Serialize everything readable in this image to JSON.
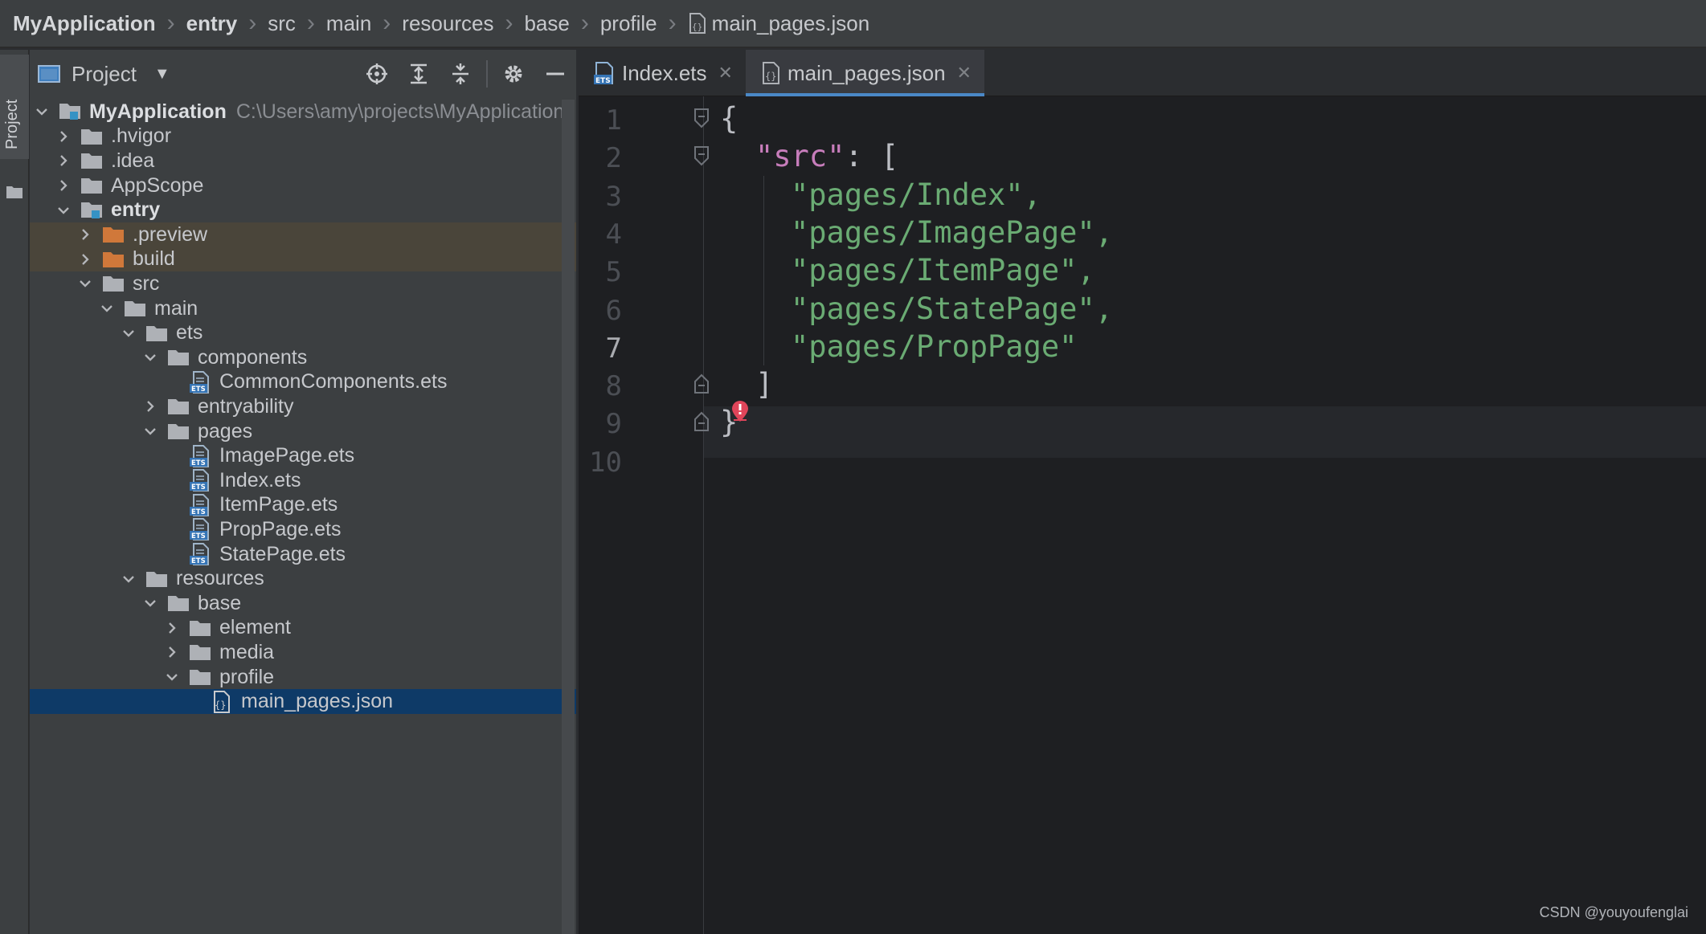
{
  "breadcrumb": {
    "items": [
      "MyApplication",
      "entry",
      "src",
      "main",
      "resources",
      "base",
      "profile",
      "main_pages.json"
    ]
  },
  "tool_strip": {
    "label": "Project"
  },
  "project_panel": {
    "title": "Project",
    "tools": [
      "locate-icon",
      "expand-all-icon",
      "collapse-all-icon",
      "gear-icon",
      "minimize-icon"
    ]
  },
  "tree": [
    {
      "label": "MyApplication",
      "path": "C:\\Users\\amy\\projects\\MyApplication",
      "bold": true,
      "expanded": true,
      "icon": "module-folder"
    },
    {
      "label": ".hvigor",
      "expanded": false,
      "icon": "folder"
    },
    {
      "label": ".idea",
      "expanded": false,
      "icon": "folder"
    },
    {
      "label": "AppScope",
      "expanded": false,
      "icon": "folder"
    },
    {
      "label": "entry",
      "bold": true,
      "expanded": true,
      "icon": "module-folder"
    },
    {
      "label": ".preview",
      "expanded": false,
      "icon": "excluded-folder"
    },
    {
      "label": "build",
      "expanded": false,
      "icon": "excluded-folder"
    },
    {
      "label": "src",
      "expanded": true,
      "icon": "folder"
    },
    {
      "label": "main",
      "expanded": true,
      "icon": "folder"
    },
    {
      "label": "ets",
      "expanded": true,
      "icon": "folder"
    },
    {
      "label": "components",
      "expanded": true,
      "icon": "folder"
    },
    {
      "label": "CommonComponents.ets",
      "icon": "ets-file"
    },
    {
      "label": "entryability",
      "expanded": false,
      "icon": "folder"
    },
    {
      "label": "pages",
      "expanded": true,
      "icon": "folder"
    },
    {
      "label": "ImagePage.ets",
      "icon": "ets-file"
    },
    {
      "label": "Index.ets",
      "icon": "ets-file"
    },
    {
      "label": "ItemPage.ets",
      "icon": "ets-file"
    },
    {
      "label": "PropPage.ets",
      "icon": "ets-file"
    },
    {
      "label": "StatePage.ets",
      "icon": "ets-file"
    },
    {
      "label": "resources",
      "expanded": true,
      "icon": "folder"
    },
    {
      "label": "base",
      "expanded": true,
      "icon": "folder"
    },
    {
      "label": "element",
      "expanded": false,
      "icon": "folder"
    },
    {
      "label": "media",
      "expanded": false,
      "icon": "folder"
    },
    {
      "label": "profile",
      "expanded": true,
      "icon": "folder"
    },
    {
      "label": "main_pages.json",
      "icon": "json-file",
      "selected": true
    }
  ],
  "tabs": [
    {
      "label": "Index.ets",
      "icon": "ets-file",
      "active": false
    },
    {
      "label": "main_pages.json",
      "icon": "json-file",
      "active": true
    }
  ],
  "editor": {
    "line_numbers": [
      "1",
      "2",
      "3",
      "4",
      "5",
      "6",
      "7",
      "8",
      "9",
      "10"
    ],
    "current_line": "7",
    "lines": [
      {
        "key": "",
        "text": "{"
      },
      {
        "key": "\"src\"",
        "text": ": ["
      },
      {
        "key": "",
        "text": "\"pages/Index\","
      },
      {
        "key": "",
        "text": "\"pages/ImagePage\","
      },
      {
        "key": "",
        "text": "\"pages/ItemPage\","
      },
      {
        "key": "",
        "text": "\"pages/StatePage\","
      },
      {
        "key": "",
        "text": "\"pages/PropPage\""
      },
      {
        "key": "",
        "text": "]"
      },
      {
        "key": "",
        "text": "}"
      },
      {
        "key": "",
        "text": ""
      }
    ]
  },
  "watermark": "CSDN @youyoufenglai",
  "colors": {
    "accent": "#4a88c7",
    "selection": "#0e3a67",
    "json_key": "#c77dbb",
    "json_string": "#6aab73",
    "error": "#e0455a"
  }
}
